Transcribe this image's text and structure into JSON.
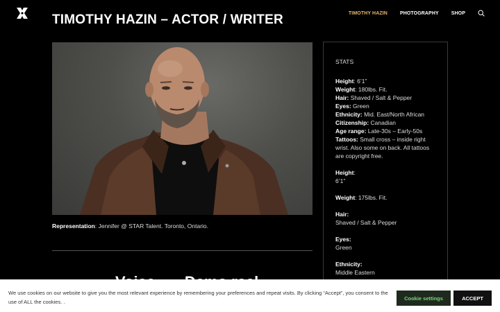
{
  "nav": {
    "items": [
      {
        "label": "TIMOTHY HAZIN",
        "active": true
      },
      {
        "label": "PHOTOGRAPHY",
        "active": false
      },
      {
        "label": "SHOP",
        "active": false
      }
    ],
    "search_icon": "search-icon",
    "logo_icon": "x-logo-icon"
  },
  "page": {
    "title": "TIMOTHY HAZIN – ACTOR / WRITER",
    "representation_label": "Representation",
    "representation_text": ": Jennifer @ STAR Talent. Toronto, Ontario.",
    "voice_heading": "Voice ..... Demo reel"
  },
  "stats": {
    "heading": "STATS",
    "block1": [
      {
        "label": "Height",
        "value": ": 6’1”"
      },
      {
        "label": "Weight",
        "value": ": 180lbs.  Fit."
      },
      {
        "label": "Hair:",
        "value": " Shaved / Salt & Pepper"
      },
      {
        "label": "Eyes:",
        "value": " Green"
      },
      {
        "label": "Ethnicity:",
        "value": " Mid. East/North African"
      },
      {
        "label": "Citizenship:",
        "value": " Canadian"
      },
      {
        "label": "Age range:",
        "value": " Late-30s – Early-50s"
      },
      {
        "label": "Tattoos:",
        "value": " Small cross – inside right wrist. Also some on back. All tattoos are copyright free."
      }
    ],
    "block2": [
      {
        "label": "Height",
        "value": ":",
        "value2": "6’1”"
      },
      {
        "label": "Weight",
        "value": ": 175lbs.  Fit.",
        "value2": ""
      },
      {
        "label": "Hair:",
        "value": "",
        "value2": "Shaved / Salt & Pepper"
      },
      {
        "label": "Eyes:",
        "value": "",
        "value2": "Green"
      },
      {
        "label": "Ethnicity:",
        "value": "",
        "value2": "Middle Eastern"
      }
    ]
  },
  "cookie": {
    "text": "We use cookies on our website to give you the most relevant experience by remembering your preferences and repeat visits. By clicking “Accept”, you consent to the use of ALL the cookies. .",
    "settings_label": "Cookie settings",
    "accept_label": "ACCEPT"
  },
  "colors": {
    "background": "#000000",
    "nav_active": "#e8b86b",
    "cookie_settings_text": "#7bd07b"
  }
}
